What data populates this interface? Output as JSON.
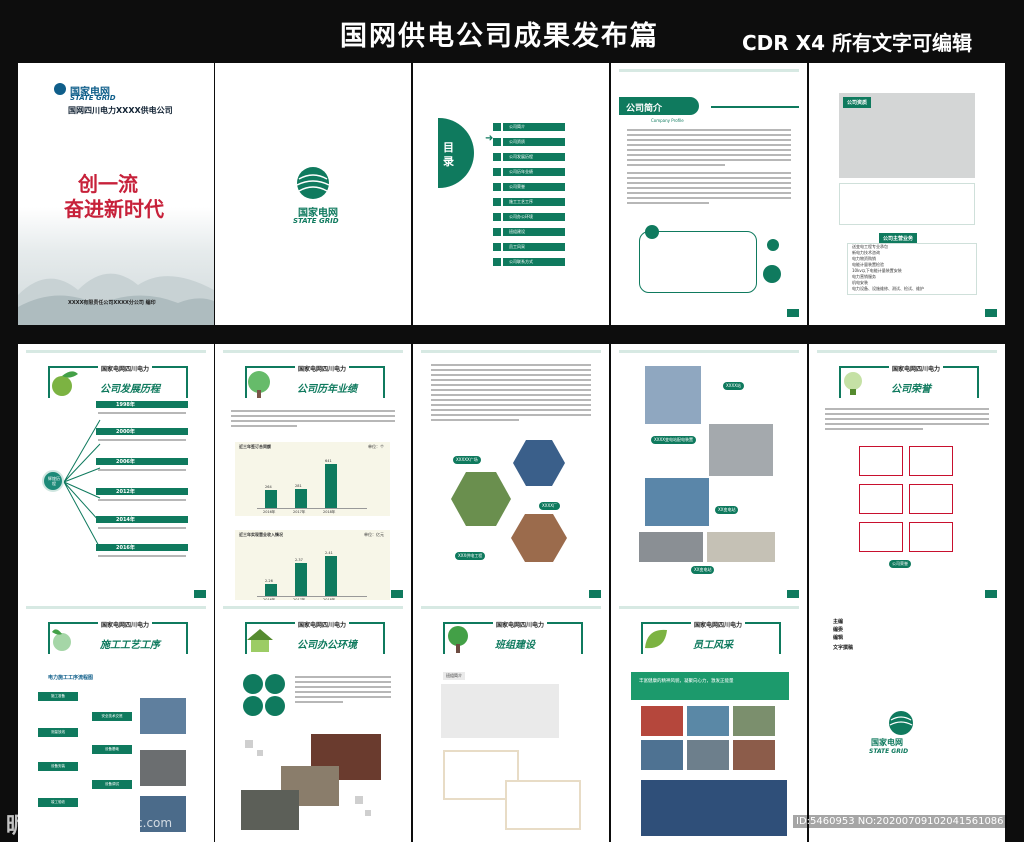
{
  "header": {
    "title": "国网供电公司成果发布篇",
    "subtitle": "CDR X4 所有文字可编辑"
  },
  "cover": {
    "logo_cn": "国家电网",
    "logo_en": "STATE GRID",
    "company": "国网四川电力XXXX供电公司",
    "slogan_line1": "创一流",
    "slogan_line2": "奋进新时代",
    "footer": "XXXX有限责任公司XXXX分公司 编印"
  },
  "logo_page": {
    "logo_cn": "国家电网",
    "logo_en": "STATE GRID"
  },
  "toc": {
    "label": "目录",
    "items": [
      "公司简介",
      "公司资质",
      "公司发展历程",
      "公司历年业绩",
      "公司荣誉",
      "施工工艺工序",
      "公司办公环境",
      "班组建设",
      "员工风采",
      "公司联系方式"
    ]
  },
  "profile": {
    "title": "公司简介",
    "title_en": "Company Profile"
  },
  "business": {
    "qual_tag": "公司资质",
    "main_tag": "公司主营业务",
    "items": [
      "送变电工程专业承包",
      "新电力技术咨询",
      "电力物资购销",
      "电能计量装置检验",
      "10kv以下电能计量装置安装",
      "电力营销服务",
      "机电安装",
      "电力设备、设施维修、测试、检试、维护"
    ]
  },
  "history": {
    "org": "国家电网四川电力",
    "title": "公司发展历程",
    "hub": "辉煌历程",
    "years": [
      "1998年",
      "2000年",
      "2006年",
      "2012年",
      "2014年",
      "2016年"
    ]
  },
  "performance": {
    "org": "国家电网四川电力",
    "title": "公司历年业绩",
    "chart1_title": "近三年签订合同额",
    "chart1_unit": "单位：个",
    "chart2_title": "近三年实现营业收入情况",
    "chart2_unit": "单位：亿元"
  },
  "chart_data": [
    {
      "type": "bar",
      "title": "近三年签订合同额",
      "ylabel": "单位：个",
      "categories": [
        "2016年",
        "2017年",
        "2018年"
      ],
      "values": [
        264,
        281,
        641
      ],
      "ylim": [
        0,
        700
      ]
    },
    {
      "type": "bar",
      "title": "近三年实现营业收入情况",
      "ylabel": "单位：亿元",
      "categories": [
        "2016年",
        "2017年",
        "2018年"
      ],
      "values": [
        2.26,
        2.37,
        2.41
      ],
      "ylim": [
        2.2,
        2.45
      ]
    }
  ],
  "projects": {
    "tags": [
      "XXXXX广场",
      "XXXX厂",
      "XXX供电工程"
    ]
  },
  "substation": {
    "tags": [
      "XXXX站",
      "XXXX变电站配电装置",
      "XX变电站",
      "XX变电站"
    ]
  },
  "honor": {
    "org": "国家电网四川电力",
    "title": "公司荣誉",
    "caption": "公司荣誉"
  },
  "construction": {
    "org": "国家电网四川电力",
    "title": "施工工艺工序",
    "flow_title": "电力施工工序流程图",
    "steps": [
      "施工准备",
      "安全技术交底",
      "测量放线",
      "设备基础",
      "设备安装",
      "设备调试",
      "竣工验收"
    ]
  },
  "office": {
    "org": "国家电网四川电力",
    "title": "公司办公环境"
  },
  "team": {
    "org": "国家电网四川电力",
    "title": "班组建设",
    "tag": "班组简介"
  },
  "staff": {
    "org": "国家电网四川电力",
    "title": "员工风采",
    "banner": "丰富健康的精神风貌，凝聚向心力，激发正能量"
  },
  "back": {
    "labels": [
      "主编",
      "编委",
      "编辑",
      "文字撰稿"
    ],
    "logo_cn": "国家电网",
    "logo_en": "STATE GRID"
  },
  "watermark": {
    "left": "昵图网",
    "url": "www.nipic.com",
    "right": "ID:5460953 NO:20200709102041561086"
  }
}
